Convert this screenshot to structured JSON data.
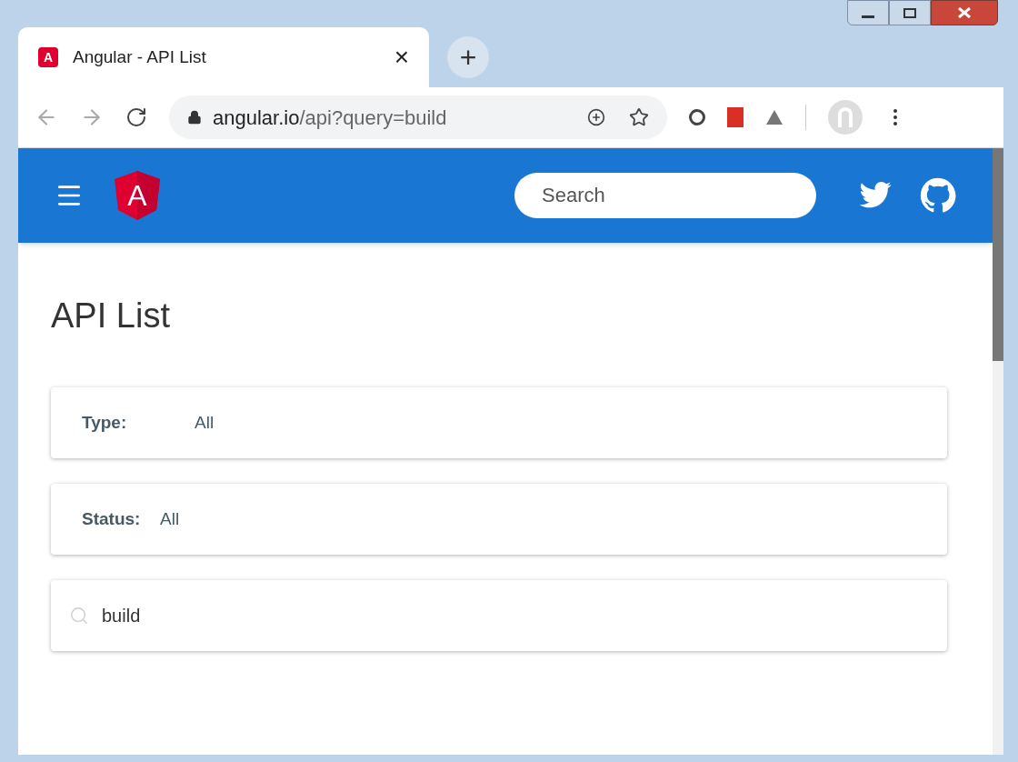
{
  "tab": {
    "favicon_letter": "A",
    "title": "Angular - API List",
    "close": "×"
  },
  "new_tab": "+",
  "address": {
    "host": "angular.io",
    "path": "/api?query=build"
  },
  "header": {
    "logo_letter": "A",
    "search": {
      "placeholder": "Search"
    }
  },
  "page": {
    "title": "API List",
    "filters": [
      {
        "kind": "select",
        "label": "Type:",
        "value": "All"
      },
      {
        "kind": "select",
        "label": "Status:",
        "value": "All"
      },
      {
        "kind": "search",
        "value": "build"
      }
    ]
  }
}
